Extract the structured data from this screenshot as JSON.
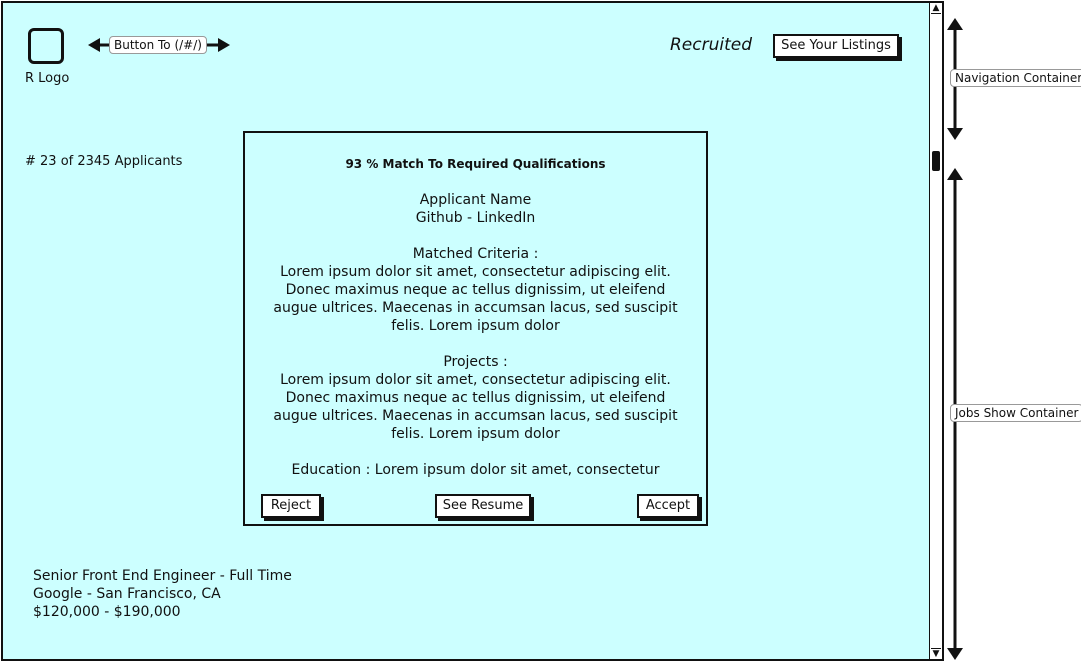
{
  "logo": {
    "label": "R Logo"
  },
  "annotations": {
    "button_to": "Button To (/#/)",
    "navigation_container": "Navigation Container",
    "jobs_show_container": "Jobs Show Container"
  },
  "header": {
    "brand": "Recruited",
    "listings_button": "See Your Listings"
  },
  "applicant_count": "# 23 of 2345 Applicants",
  "card": {
    "title": "93 % Match To Required Qualifications",
    "applicant_name": "Applicant Name",
    "links": "Github - LinkedIn",
    "matched_label": "Matched Criteria :",
    "matched_text": "Lorem ipsum dolor sit amet, consectetur adipiscing elit. Donec maximus neque ac tellus dignissim, ut eleifend augue ultrices. Maecenas in accumsan lacus, sed suscipit felis. Lorem ipsum dolor",
    "projects_label": "Projects :",
    "projects_text": "Lorem ipsum dolor sit amet, consectetur adipiscing elit. Donec maximus neque ac tellus dignissim, ut eleifend augue ultrices. Maecenas in accumsan lacus, sed suscipit felis. Lorem ipsum dolor",
    "education": "Education : Lorem ipsum dolor sit amet, consectetur",
    "reject_label": "Reject",
    "resume_label": "See Resume",
    "accept_label": "Accept"
  },
  "job": {
    "title": "Senior Front End Engineer - Full Time",
    "company": "Google - San Francisco, CA",
    "salary": "$120,000 - $190,000"
  },
  "colors": {
    "background": "#ccffff",
    "border": "#111111"
  }
}
